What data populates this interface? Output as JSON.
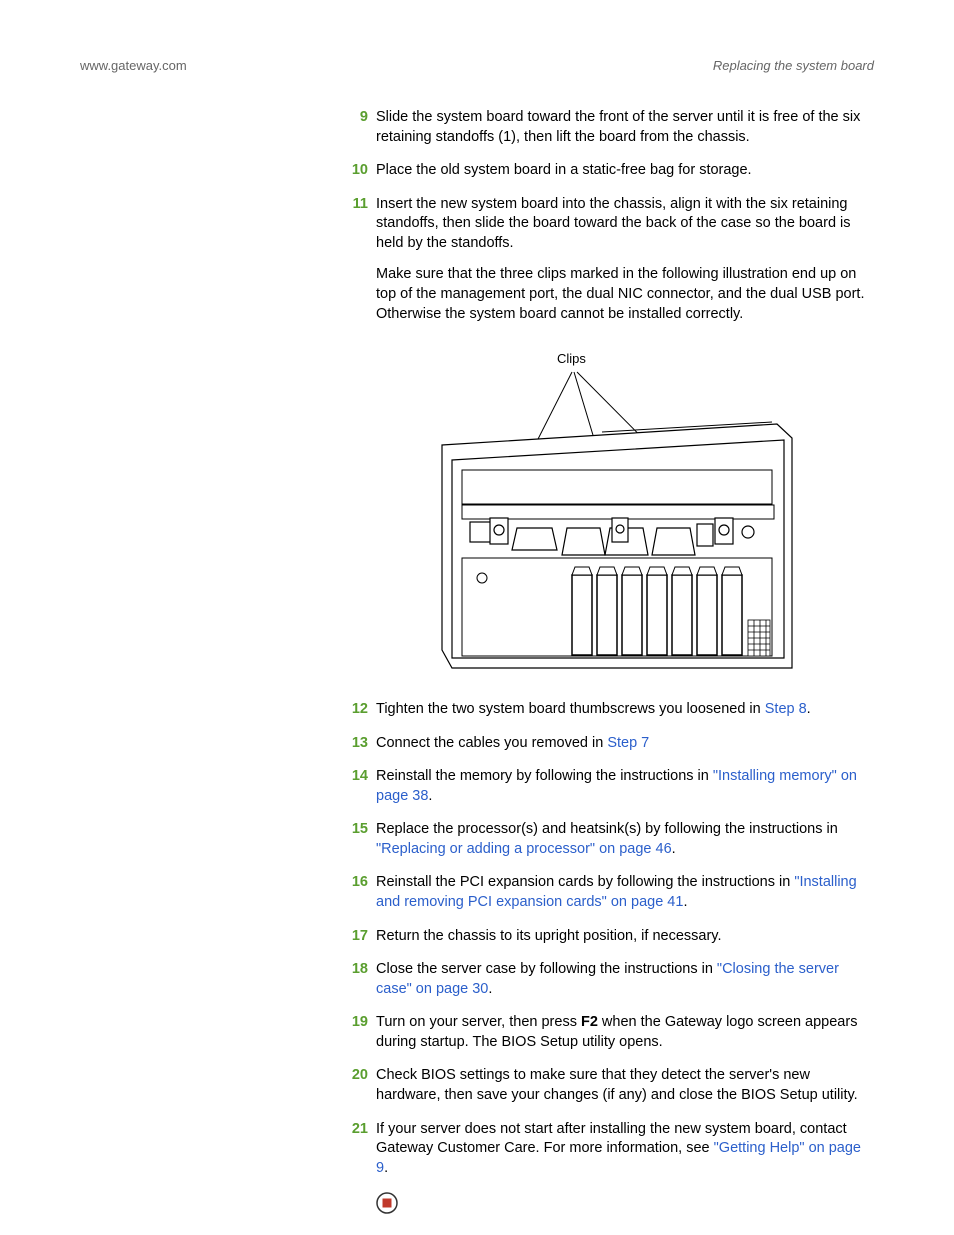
{
  "header": {
    "left": "www.gateway.com",
    "right": "Replacing the system board"
  },
  "figure": {
    "clips_label": "Clips"
  },
  "steps": {
    "s9": {
      "num": "9",
      "text": "Slide the system board toward the front of the server until it is free of the six retaining standoffs (1), then lift the board from the chassis."
    },
    "s10": {
      "num": "10",
      "text": "Place the old system board in a static-free bag for storage."
    },
    "s11": {
      "num": "11",
      "p1": "Insert the new system board into the chassis, align it with the six retaining standoffs, then slide the board toward the back of the case so the board is held by the standoffs.",
      "p2": "Make sure that the three clips marked in the following illustration end up on top of the management port, the dual NIC connector, and the dual USB port. Otherwise the system board cannot be installed correctly."
    },
    "s12": {
      "num": "12",
      "pre": "Tighten the two system board thumbscrews you loosened in ",
      "link": "Step 8",
      "post": "."
    },
    "s13": {
      "num": "13",
      "pre": "Connect the cables you removed in ",
      "link": "Step 7"
    },
    "s14": {
      "num": "14",
      "pre": "Reinstall the memory by following the instructions in ",
      "link": "\"Installing memory\" on page 38",
      "post": "."
    },
    "s15": {
      "num": "15",
      "pre": "Replace the processor(s) and heatsink(s) by following the instructions in ",
      "link": "\"Replacing or adding a processor\" on page 46",
      "post": "."
    },
    "s16": {
      "num": "16",
      "pre": "Reinstall the PCI expansion cards by following the instructions in ",
      "link": "\"Installing and removing PCI expansion cards\" on page 41",
      "post": "."
    },
    "s17": {
      "num": "17",
      "text": "Return the chassis to its upright position, if necessary."
    },
    "s18": {
      "num": "18",
      "pre": "Close the server case by following the instructions in ",
      "link": "\"Closing the server case\" on page 30",
      "post": "."
    },
    "s19": {
      "num": "19",
      "pre": "Turn on your server, then press ",
      "bold": "F2",
      "post": " when the Gateway logo screen appears during startup. The BIOS Setup utility opens."
    },
    "s20": {
      "num": "20",
      "text": "Check BIOS settings to make sure that they detect the server's new hardware, then save your changes (if any) and close the BIOS Setup utility."
    },
    "s21": {
      "num": "21",
      "pre": "If your server does not start after installing the new system board, contact Gateway Customer Care. For more information, see ",
      "link": "\"Getting Help\" on page 9",
      "post": "."
    }
  }
}
